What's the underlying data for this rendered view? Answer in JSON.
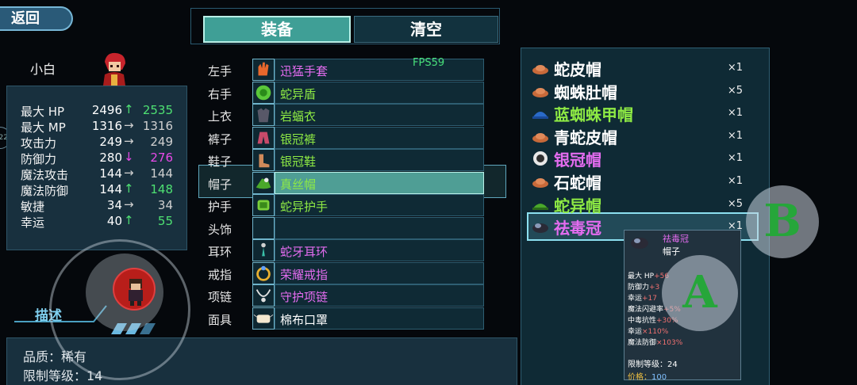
{
  "back_label": "返回",
  "left_edge_text": "22",
  "character": {
    "name": "小白"
  },
  "stats": [
    {
      "name": "最大 HP",
      "current": "2496",
      "trend": "up",
      "new": "2535"
    },
    {
      "name": "最大 MP",
      "current": "1316",
      "trend": "same",
      "new": "1316"
    },
    {
      "name": "攻击力",
      "current": "249",
      "trend": "same",
      "new": "249"
    },
    {
      "name": "防御力",
      "current": "280",
      "trend": "down",
      "new": "276"
    },
    {
      "name": "魔法攻击",
      "current": "144",
      "trend": "same",
      "new": "144"
    },
    {
      "name": "魔法防御",
      "current": "144",
      "trend": "up",
      "new": "148"
    },
    {
      "name": "敏捷",
      "current": "34",
      "trend": "same",
      "new": "34"
    },
    {
      "name": "幸运",
      "current": "40",
      "trend": "up",
      "new": "55"
    }
  ],
  "tabs": {
    "equip": "装备",
    "clear": "清空"
  },
  "fps": "FPS59",
  "slots": [
    {
      "label": "左手",
      "item": "迅猛手套",
      "color": "#e46cf0",
      "icon": "glove-icon"
    },
    {
      "label": "右手",
      "item": "蛇异盾",
      "color": "#8eea44",
      "icon": "shield-icon"
    },
    {
      "label": "上衣",
      "item": "岩蝠衣",
      "color": "#8eea44",
      "icon": "armor-icon"
    },
    {
      "label": "裤子",
      "item": "银冠裤",
      "color": "#8eea44",
      "icon": "pants-icon"
    },
    {
      "label": "鞋子",
      "item": "银冠鞋",
      "color": "#8eea44",
      "icon": "boots-icon"
    },
    {
      "label": "帽子",
      "item": "真丝帽",
      "color": "#8eea44",
      "icon": "hat-icon"
    },
    {
      "label": "护手",
      "item": "蛇异护手",
      "color": "#8eea44",
      "icon": "gauntlet-icon"
    },
    {
      "label": "头饰",
      "item": "",
      "color": "#ffffff",
      "icon": ""
    },
    {
      "label": "耳环",
      "item": "蛇牙耳环",
      "color": "#e46cf0",
      "icon": "earring-icon"
    },
    {
      "label": "戒指",
      "item": "荣耀戒指",
      "color": "#e46cf0",
      "icon": "ring-icon"
    },
    {
      "label": "项链",
      "item": "守护项链",
      "color": "#e46cf0",
      "icon": "necklace-icon"
    },
    {
      "label": "面具",
      "item": "棉布口罩",
      "color": "#ffffff",
      "icon": "mask-icon"
    }
  ],
  "hats": [
    {
      "name": "蛇皮帽",
      "count": "×1",
      "color": "#ffffff",
      "icon": "brown-cap-icon"
    },
    {
      "name": "蜘蛛肚帽",
      "count": "×5",
      "color": "#ffffff",
      "icon": "brown-cap-icon"
    },
    {
      "name": "蓝蜘蛛甲帽",
      "count": "×1",
      "color": "#8eea44",
      "icon": "blue-helmet-icon"
    },
    {
      "name": "青蛇皮帽",
      "count": "×1",
      "color": "#ffffff",
      "icon": "brown-cap-icon"
    },
    {
      "name": "银冠帽",
      "count": "×1",
      "color": "#e46cf0",
      "icon": "skull-helmet-icon"
    },
    {
      "name": "石蛇帽",
      "count": "×1",
      "color": "#ffffff",
      "icon": "brown-cap-icon"
    },
    {
      "name": "蛇异帽",
      "count": "×5",
      "color": "#8eea44",
      "icon": "green-cap-icon"
    },
    {
      "name": "祛毒冠",
      "count": "×1",
      "color": "#e46cf0",
      "icon": "dark-crown-icon"
    }
  ],
  "tooltip": {
    "title": "祛毒冠",
    "type": "帽子",
    "lines": [
      {
        "label": "最大 HP",
        "value": "+56"
      },
      {
        "label": "防御力",
        "value": "+3"
      },
      {
        "label": "幸运",
        "value": "+17"
      },
      {
        "label": "魔法闪避率",
        "value": "+5%"
      },
      {
        "label": "中毒抗性",
        "value": "+30%"
      },
      {
        "label": "幸运",
        "value": "×110%"
      },
      {
        "label": "魔法防御",
        "value": "×103%"
      }
    ],
    "level": "限制等级：24",
    "price_label": "价格：",
    "price": "100"
  },
  "describe": {
    "title": "描述",
    "quality": "品质：稀有",
    "level": "限制等级：14"
  },
  "buttons": {
    "a": "A",
    "b": "B"
  },
  "colors": {
    "up": "#4ee072",
    "down": "#e84ae8",
    "rare": "#e46cf0",
    "uncommon": "#8eea44"
  }
}
